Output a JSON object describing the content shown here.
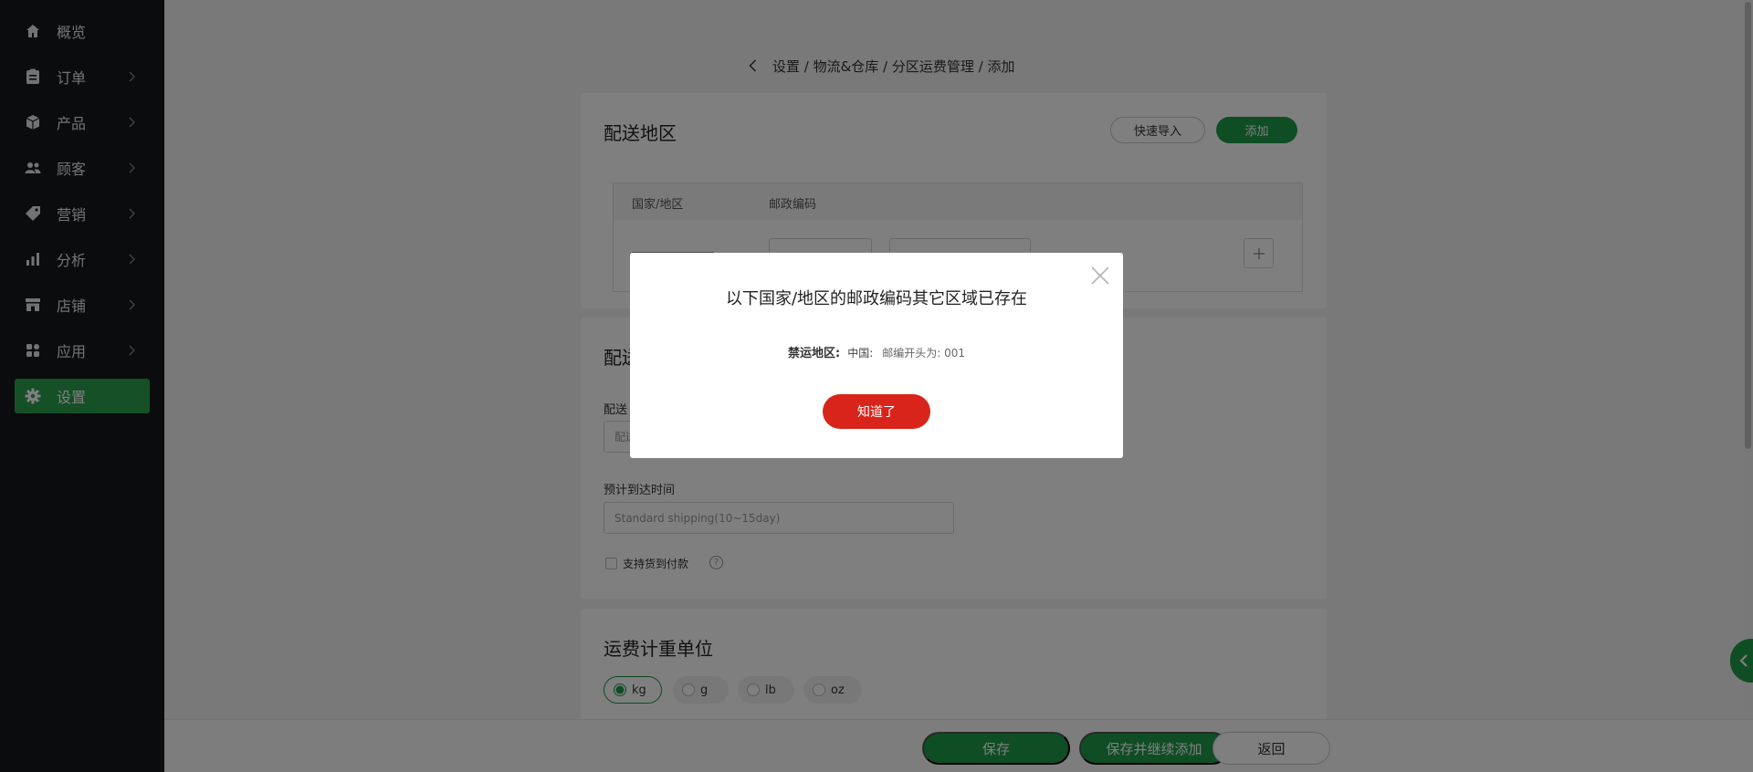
{
  "sidebar": {
    "items": [
      {
        "label": "概览",
        "icon": "home-icon",
        "has_chevron": false
      },
      {
        "label": "订单",
        "icon": "clipboard-icon",
        "has_chevron": true
      },
      {
        "label": "产品",
        "icon": "box-icon",
        "has_chevron": true
      },
      {
        "label": "顾客",
        "icon": "users-icon",
        "has_chevron": true
      },
      {
        "label": "营销",
        "icon": "tag-icon",
        "has_chevron": true
      },
      {
        "label": "分析",
        "icon": "bar-chart-icon",
        "has_chevron": true
      },
      {
        "label": "店铺",
        "icon": "store-icon",
        "has_chevron": true
      },
      {
        "label": "应用",
        "icon": "apps-icon",
        "has_chevron": true
      },
      {
        "label": "设置",
        "icon": "gear-icon",
        "has_chevron": false,
        "active": true
      }
    ]
  },
  "breadcrumb": "设置 / 物流&仓库 / 分区运费管理 / 添加",
  "delivery_region": {
    "title": "配送地区",
    "quick_import_label": "快速导入",
    "add_label": "添加",
    "columns": [
      "国家/地区",
      "邮政编码"
    ]
  },
  "delivery_method": {
    "title_partial": "配送",
    "field_label_partial": "配送",
    "field_value_partial": "配送",
    "eta_label": "预计到达时间",
    "eta_placeholder": "Standard shipping(10~15day)",
    "cod_label": "支持货到付款",
    "help_glyph": "?"
  },
  "weight_unit": {
    "title": "运费计重单位",
    "options": [
      "kg",
      "g",
      "lb",
      "oz"
    ],
    "selected": "kg"
  },
  "footer": {
    "save_label": "保存",
    "save_continue_label": "保存并继续添加",
    "back_label": "返回"
  },
  "modal": {
    "title": "以下国家/地区的邮政编码其它区域已存在",
    "message_key": "禁运地区:",
    "message_country": "中国:",
    "message_value": "邮编开头为: 001",
    "confirm_label": "知道了"
  },
  "colors": {
    "sidebar_bg": "#16191d",
    "accent_green": "#1f9a4a",
    "danger_red": "#d9241b"
  }
}
